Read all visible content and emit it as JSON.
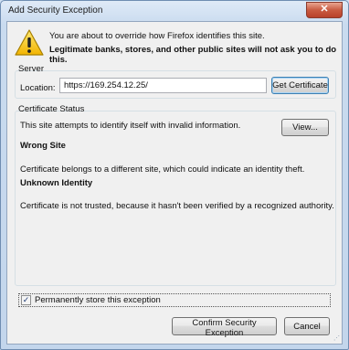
{
  "window": {
    "title": "Add Security Exception",
    "close_icon": "close-icon"
  },
  "intro": {
    "line1": "You are about to override how Firefox identifies this site.",
    "line2": "Legitimate banks, stores, and other public sites will not ask you to do this.",
    "icon": "warning-icon"
  },
  "server": {
    "group_label": "Server",
    "location_label": "Location:",
    "location_value": "https://169.254.12.25/",
    "get_certificate_label": "Get Certificate"
  },
  "certificate_status": {
    "group_label": "Certificate Status",
    "summary": "This site attempts to identify itself with invalid information.",
    "view_label": "View...",
    "wrong_site_heading": "Wrong Site",
    "wrong_site_text": "Certificate belongs to a different site, which could indicate an identity theft.",
    "unknown_identity_heading": "Unknown Identity",
    "unknown_identity_text": "Certificate is not trusted, because it hasn't been verified by a recognized authority."
  },
  "permanent": {
    "label": "Permanently store this exception",
    "checked": true
  },
  "buttons": {
    "confirm_label": "Confirm Security Exception",
    "cancel_label": "Cancel"
  }
}
